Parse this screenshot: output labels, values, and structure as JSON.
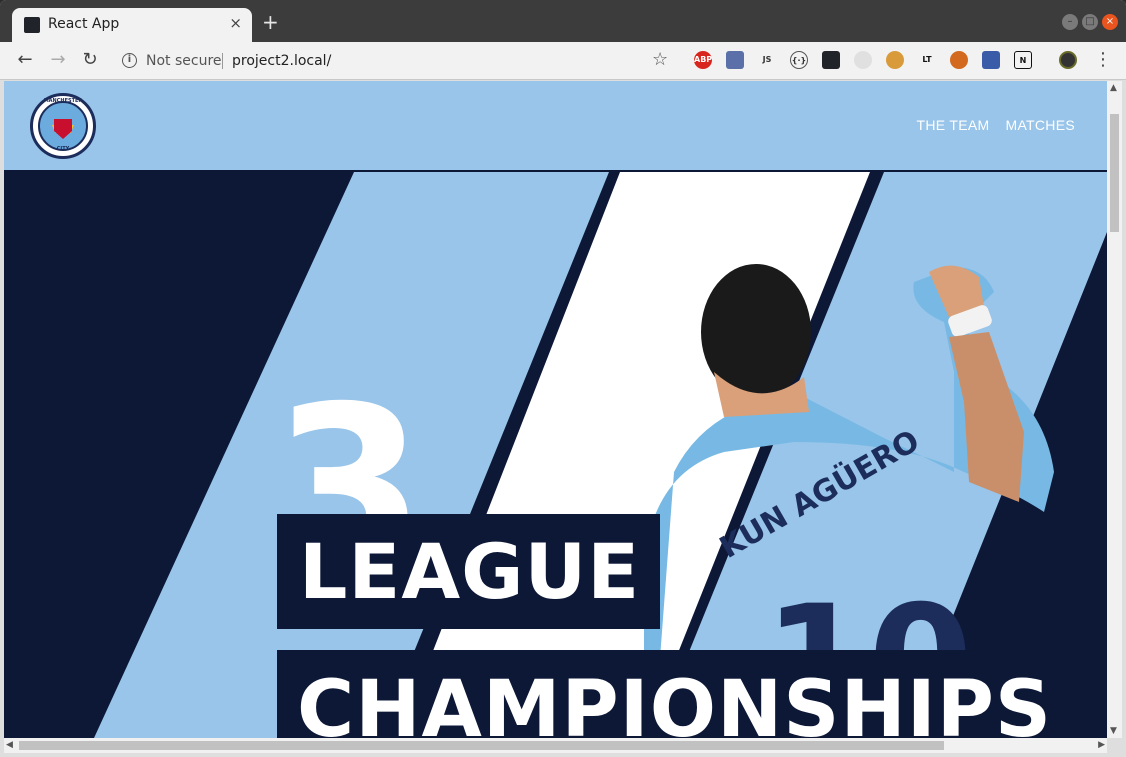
{
  "browser": {
    "tab_title": "React App",
    "tab_close": "×",
    "new_tab": "+",
    "not_secure": "Not secure",
    "url": "project2.local/",
    "extensions": [
      "ABP",
      "",
      "JS",
      "{·}",
      "",
      "",
      "",
      "LT",
      "",
      "",
      "N"
    ],
    "accent": "#3c3c3c"
  },
  "site": {
    "crest_top": "MANCHESTER",
    "crest_bottom": "CITY",
    "nav": [
      "THE TEAM",
      "MATCHES"
    ],
    "header_color": "#98c5e9",
    "navy": "#0d1837"
  },
  "hero": {
    "number": "3",
    "line1": "LEAGUE",
    "line2": "CHAMPIONSHIPS",
    "jersey_name": "KUN AGÜERO",
    "jersey_number": "10"
  }
}
